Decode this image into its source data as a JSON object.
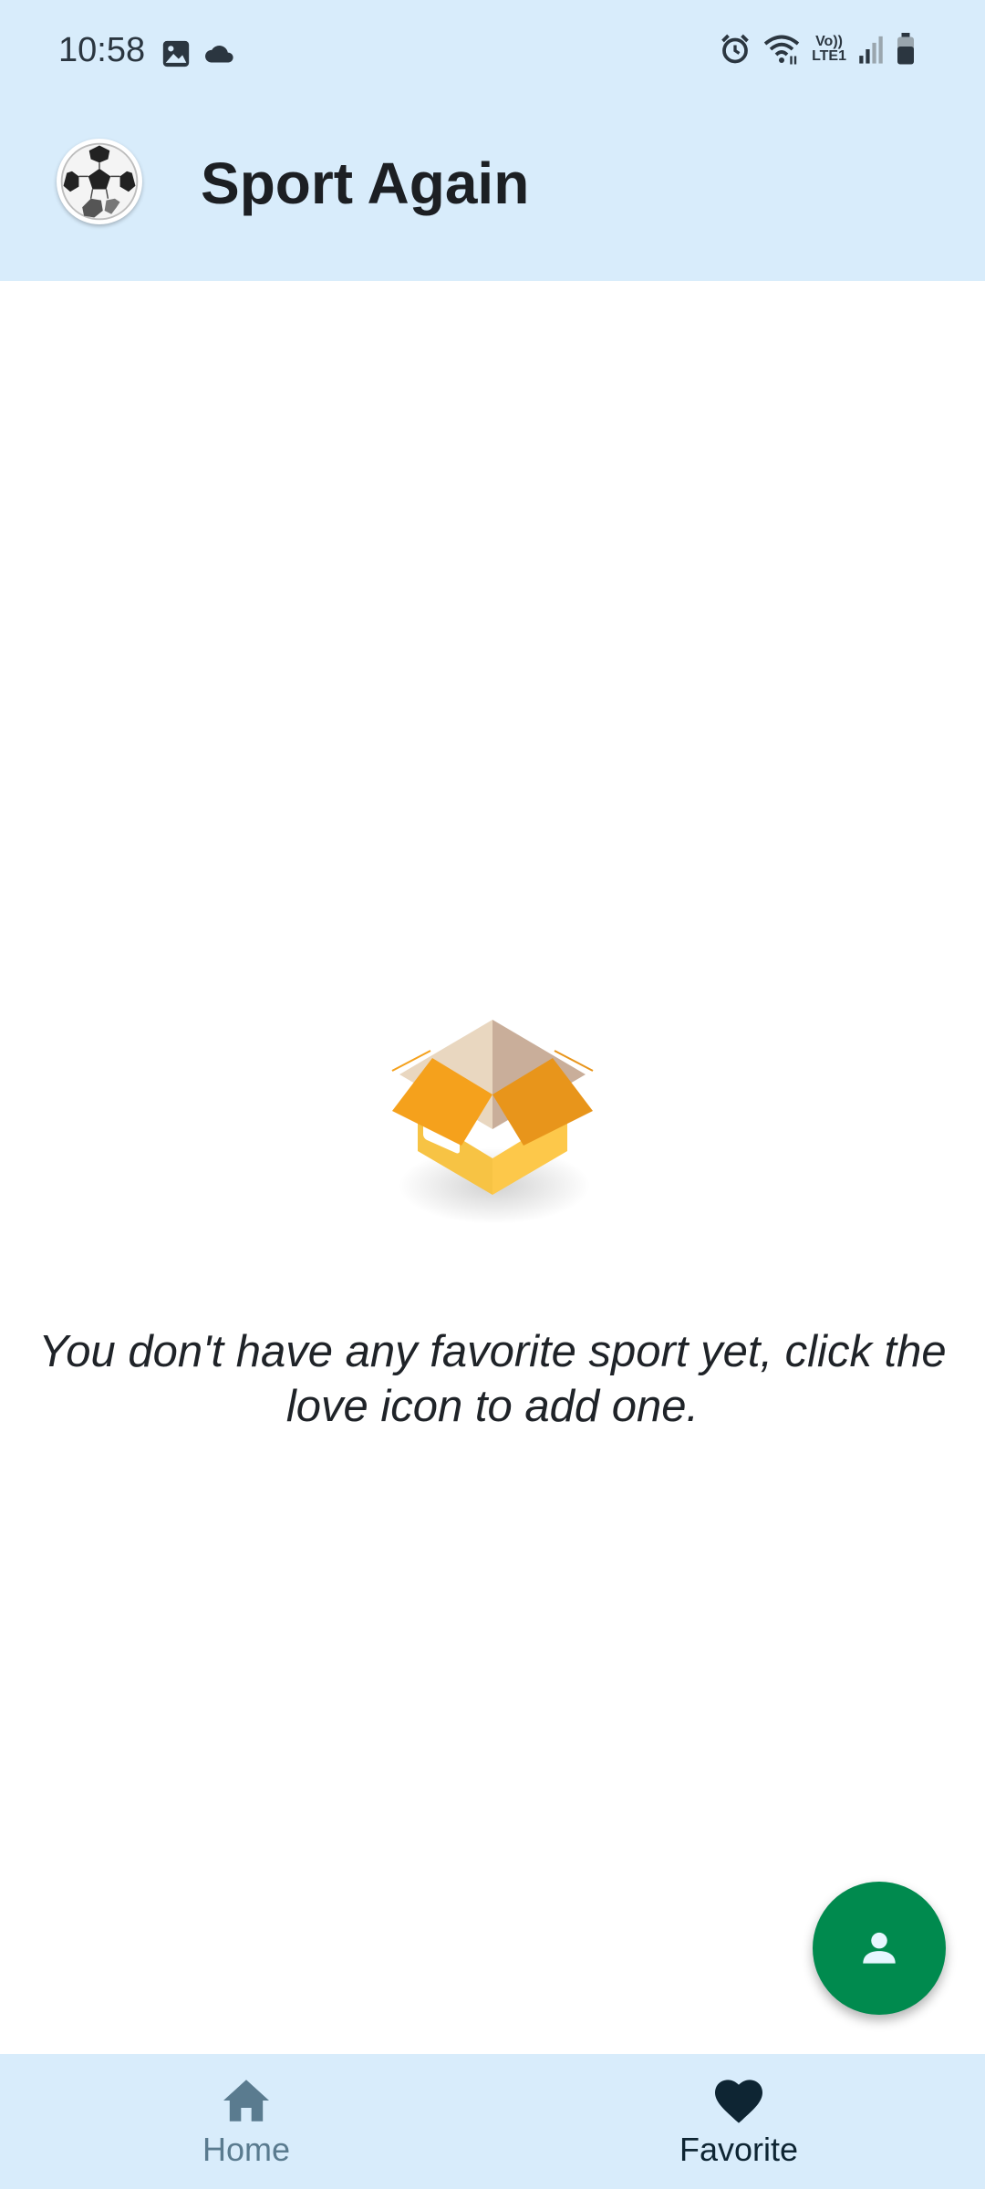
{
  "status_bar": {
    "time": "10:58",
    "left_icons": [
      "gallery-icon",
      "cloud-icon"
    ],
    "right_icons": [
      "alarm-icon",
      "wifi-icon",
      "volte-icon",
      "signal-icon",
      "battery-icon"
    ],
    "volte_line1": "Vo))",
    "volte_line2": "LTE1"
  },
  "app_bar": {
    "title": "Sport Again",
    "logo_icon": "soccer-ball-icon"
  },
  "main": {
    "empty_illustration": "open-box-icon",
    "empty_message": "You don't have any favorite sport yet, click the love icon to add one."
  },
  "fab": {
    "icon": "person-icon",
    "color": "#008a4e"
  },
  "bottom_nav": {
    "items": [
      {
        "label": "Home",
        "icon": "home-icon",
        "selected": false
      },
      {
        "label": "Favorite",
        "icon": "heart-icon",
        "selected": true
      }
    ]
  },
  "colors": {
    "header_bg": "#d8ecfb",
    "fab": "#008a4e",
    "nav_selected": "#0e2533",
    "nav_unselected": "#5a7b8f"
  }
}
